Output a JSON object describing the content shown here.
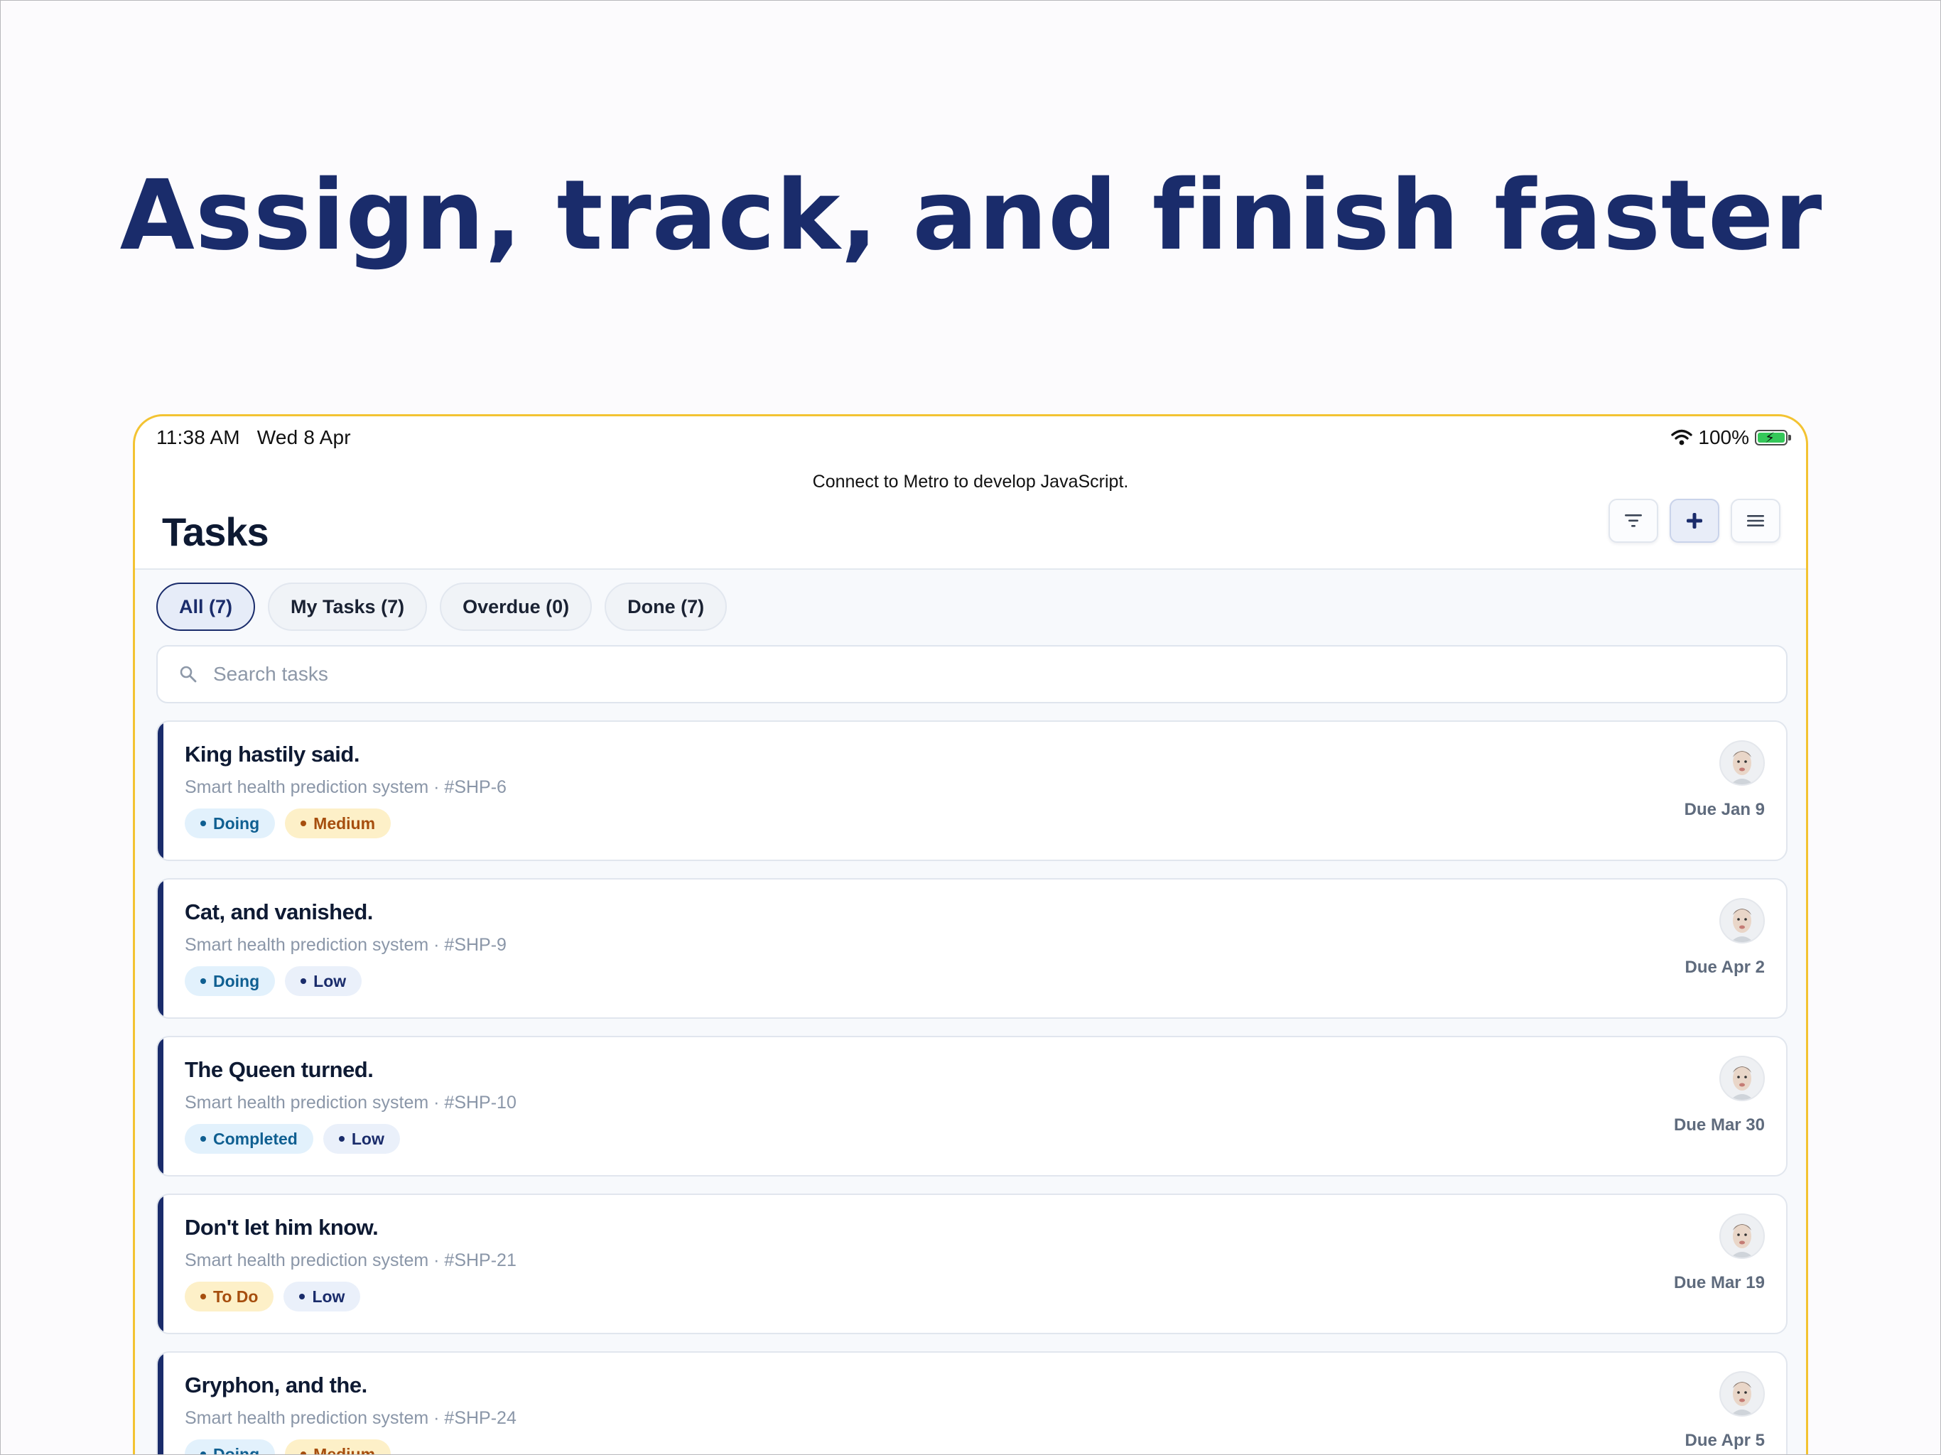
{
  "hero": {
    "headline": "Assign, track, and finish faster"
  },
  "status_bar": {
    "time": "11:38 AM",
    "date": "Wed 8 Apr",
    "battery": "100%"
  },
  "banner": {
    "text": "Connect to Metro to develop JavaScript."
  },
  "header": {
    "title": "Tasks",
    "actions": [
      {
        "icon": "filter-icon"
      },
      {
        "icon": "plus-icon"
      },
      {
        "icon": "menu-icon"
      }
    ]
  },
  "tabs": [
    {
      "label": "All (7)",
      "active": true
    },
    {
      "label": "My Tasks (7)",
      "active": false
    },
    {
      "label": "Overdue (0)",
      "active": false
    },
    {
      "label": "Done (7)",
      "active": false
    }
  ],
  "search": {
    "placeholder": "Search tasks",
    "value": ""
  },
  "tasks": [
    {
      "title": "King hastily said.",
      "meta": "Smart health prediction system · #SHP-6",
      "status": "Doing",
      "priority": "Medium",
      "due": "Due Jan 9"
    },
    {
      "title": "Cat, and vanished.",
      "meta": "Smart health prediction system · #SHP-9",
      "status": "Doing",
      "priority": "Low",
      "due": "Due Apr 2"
    },
    {
      "title": "The Queen turned.",
      "meta": "Smart health prediction system · #SHP-10",
      "status": "Completed",
      "priority": "Low",
      "due": "Due Mar 30"
    },
    {
      "title": "Don't let him know.",
      "meta": "Smart health prediction system · #SHP-21",
      "status": "To Do",
      "priority": "Low",
      "due": "Due Mar 19"
    },
    {
      "title": "Gryphon, and the.",
      "meta": "Smart health prediction system · #SHP-24",
      "status": "Doing",
      "priority": "Medium",
      "due": "Due Apr 5"
    }
  ],
  "colors": {
    "accent": "#1a2c6b",
    "device_border": "#f3c332",
    "status_doing": "#0f5f91",
    "priority_medium": "#a64e0e"
  }
}
